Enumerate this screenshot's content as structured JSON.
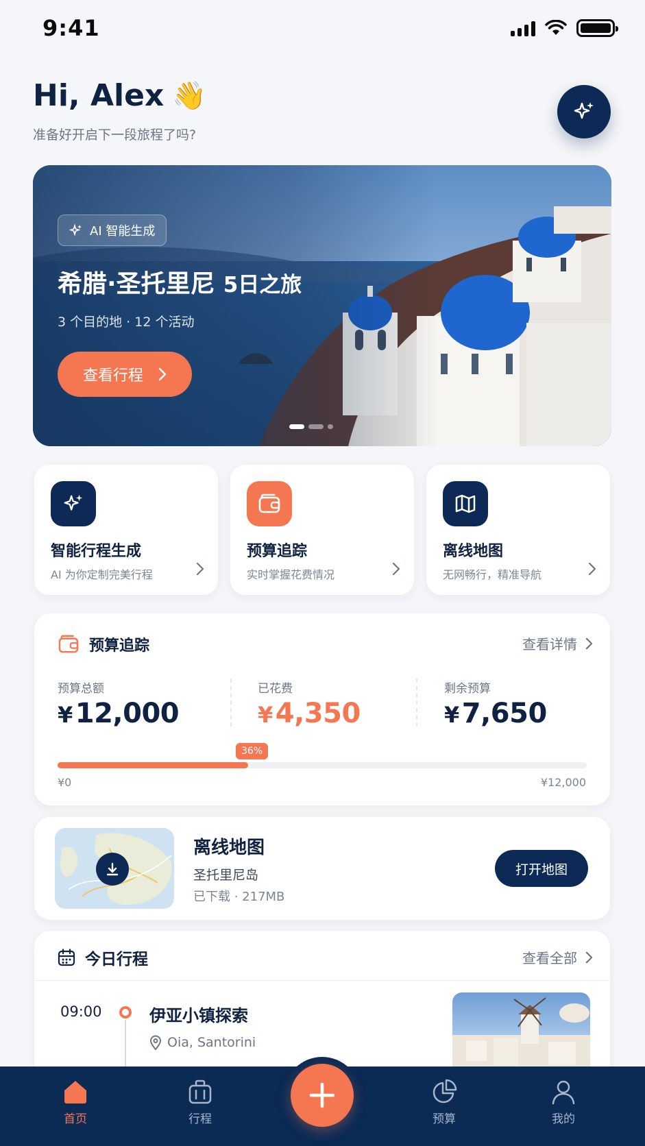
{
  "status": {
    "time": "9:41"
  },
  "header": {
    "greeting": "Hi, Alex",
    "wave_emoji": "👋",
    "subtitle": "准备好开启下一段旅程了吗?"
  },
  "hero": {
    "chip": "AI 智能生成",
    "title": "希腊·圣托里尼",
    "title_days": "5日之旅",
    "meta": "3 个目的地 · 12 个活动",
    "cta": "查看行程"
  },
  "features": [
    {
      "title": "智能行程生成",
      "subtitle": "AI 为你定制完美行程",
      "icon": "sparkle-icon",
      "color": "#0c2a55"
    },
    {
      "title": "预算追踪",
      "subtitle": "实时掌握花费情况",
      "icon": "wallet-icon",
      "color": "#f47752"
    },
    {
      "title": "离线地图",
      "subtitle": "无网畅行，精准导航",
      "icon": "map-icon",
      "color": "#0c2a55"
    }
  ],
  "budget": {
    "title": "预算追踪",
    "link": "查看详情",
    "total_label": "预算总额",
    "total_value": "12,000",
    "spent_label": "已花费",
    "spent_value": "4,350",
    "remaining_label": "剩余预算",
    "remaining_value": "7,650",
    "currency": "¥",
    "progress_percent": 36,
    "progress_label": "36%",
    "min_label": "¥0",
    "max_label": "¥12,000"
  },
  "offline_map": {
    "title": "离线地图",
    "place": "圣托里尼岛",
    "meta": "已下载 · 217MB",
    "button": "打开地图"
  },
  "today": {
    "title": "今日行程",
    "link": "查看全部",
    "items": [
      {
        "time": "09:00",
        "activity": "伊亚小镇探索",
        "location": "Oia, Santorini"
      }
    ]
  },
  "nav": {
    "home": "首页",
    "trips": "行程",
    "budget": "预算",
    "me": "我的"
  },
  "colors": {
    "navy": "#0c2a55",
    "accent": "#f47752"
  }
}
